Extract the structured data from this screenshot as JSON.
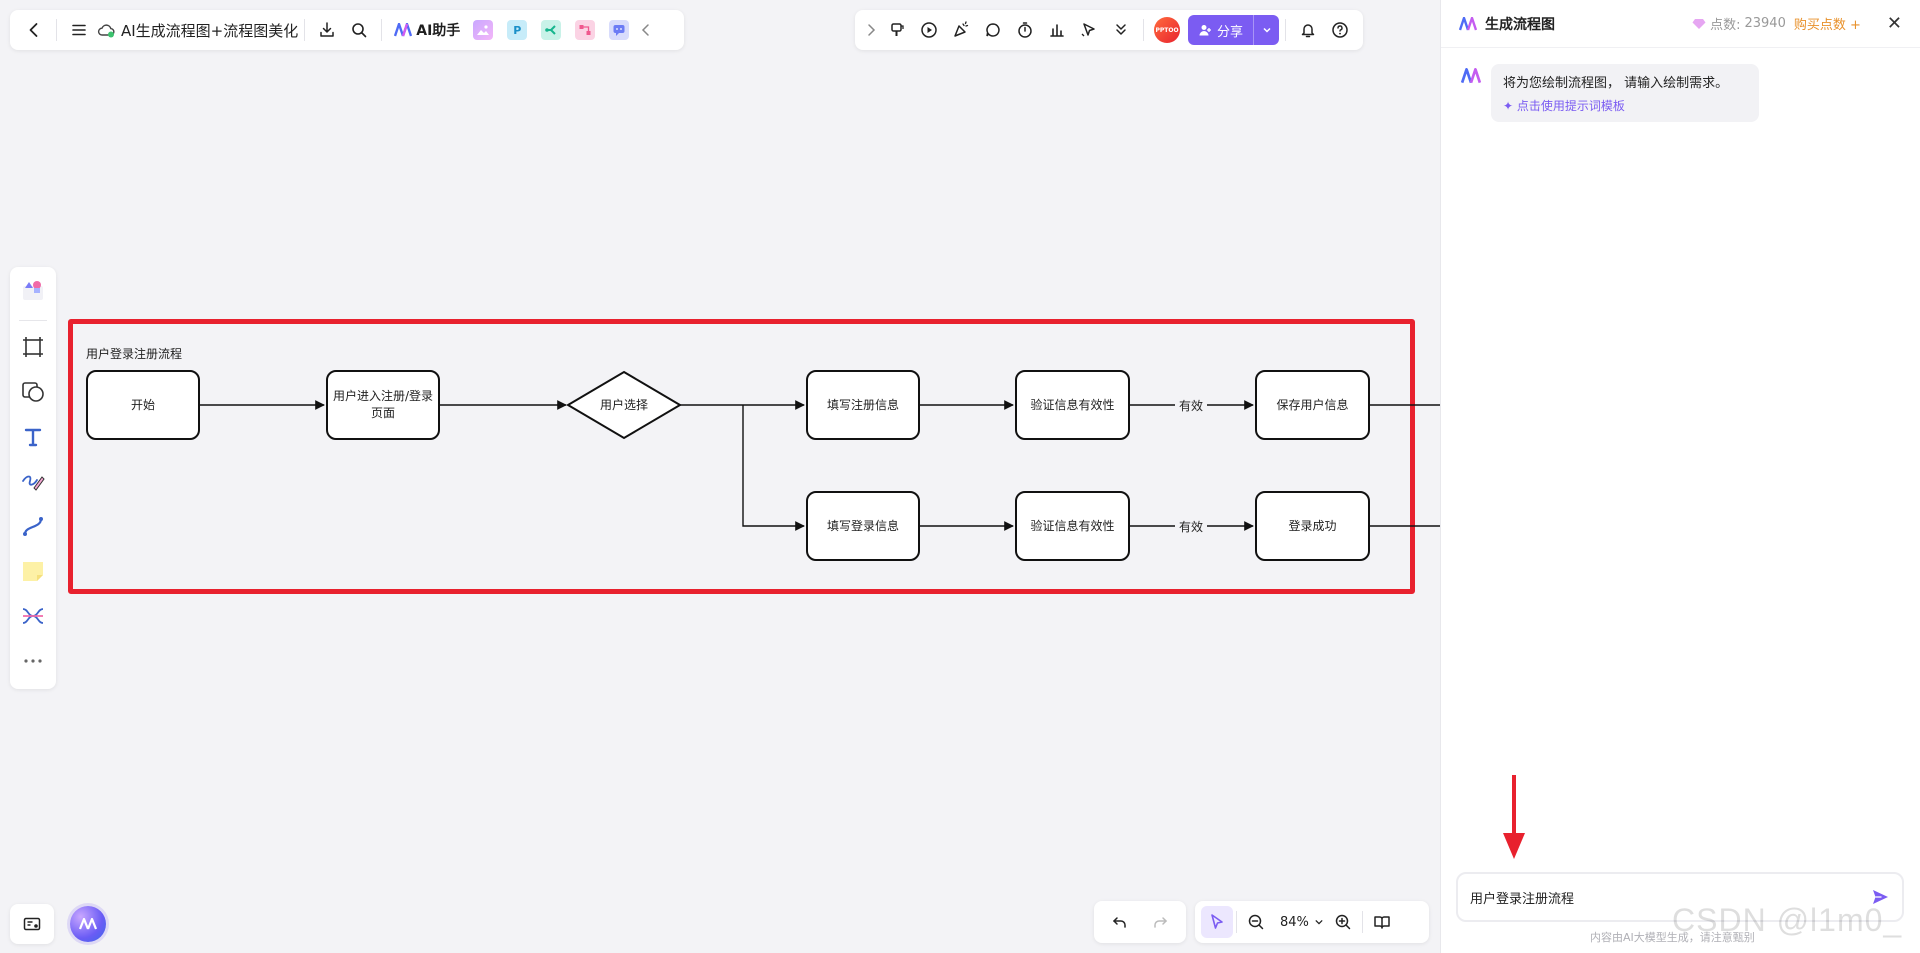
{
  "toolbar_left": {
    "doc_title": "AI生成流程图+流程图美化",
    "ai_assistant_label": "AI助手"
  },
  "toolbar_right": {
    "share_label": "分享",
    "avatar_text": "PPTOO"
  },
  "flowchart": {
    "title": "用户登录注册流程",
    "nodes": {
      "start": "开始",
      "enter_page": "用户进入注册/登录页面",
      "user_choice": "用户选择",
      "fill_register": "填写注册信息",
      "validate_1": "验证信息有效性",
      "save_user": "保存用户信息",
      "fill_login": "填写登录信息",
      "validate_2": "验证信息有效性",
      "login_success": "登录成功"
    },
    "edge_labels": {
      "valid_1": "有效",
      "valid_2": "有效"
    }
  },
  "bottom_bar": {
    "zoom_level": "84%"
  },
  "panel": {
    "title": "生成流程图",
    "points_label": "点数:",
    "points_value": "23940",
    "buy_label": "购买点数",
    "message": "将为您绘制流程图， 请输入绘制需求。",
    "template_link": "点击使用提示词模板",
    "input_value": "用户登录注册流程",
    "disclaimer": "内容由AI大模型生成，请注意甄别"
  },
  "watermark": "CSDN @l1m0_",
  "colors": {
    "accent": "#7b5cf2",
    "highlight_frame": "#e8212e",
    "canvas_bg": "#f3f3f6"
  }
}
